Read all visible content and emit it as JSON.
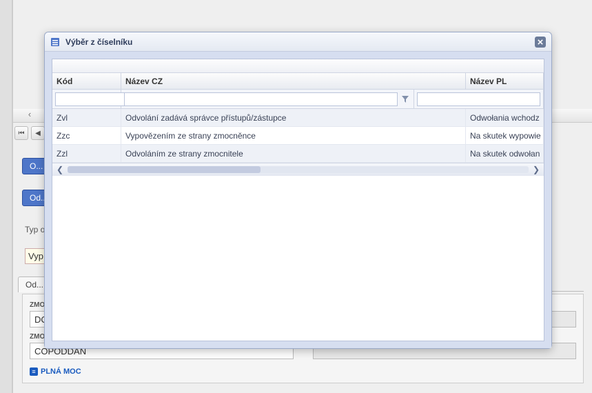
{
  "bg": {
    "nav_prev": "‹",
    "nav_next": "›",
    "page_num": "",
    "od1": "O...",
    "od2": "Od...",
    "typ_label": "Typ o...",
    "typ_value": "Vyp",
    "tab1": "Od...",
    "zmo1_label": "ZMO...",
    "zmo1_value": "DC...",
    "zmo2_label": "ZMO...",
    "zmo2_value": "COPODDAN",
    "blank_value": "",
    "panel_link": "PLNÁ MOC"
  },
  "modal": {
    "title": "Výběr z číselníku",
    "columns": {
      "kod": "Kód",
      "cz": "Název CZ",
      "pl": "Název PL"
    },
    "rows": [
      {
        "kod": "Zvl",
        "cz": "Odvolání zadává správce přístupů/zástupce",
        "pl": "Odwołania wchodz"
      },
      {
        "kod": "Zzc",
        "cz": "Vypovězením ze strany zmocněnce",
        "pl": "Na skutek wypowie"
      },
      {
        "kod": "Zzl",
        "cz": "Odvoláním ze strany zmocnitele",
        "pl": "Na skutek odwołan"
      }
    ]
  }
}
